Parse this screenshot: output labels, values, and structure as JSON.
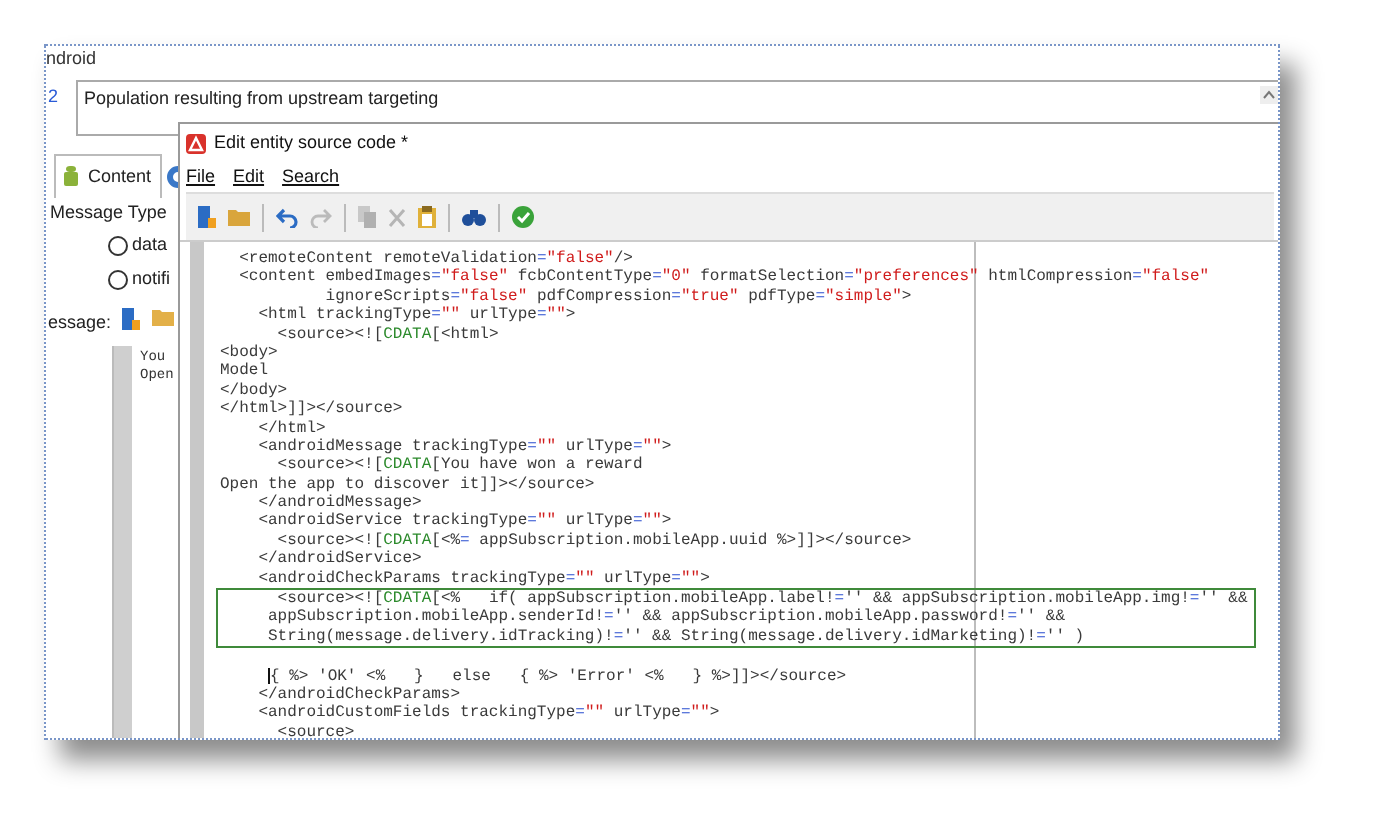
{
  "background_window": {
    "section_title": "ndroid",
    "field_number": "2",
    "description": "Population resulting from upstream targeting",
    "tabs": [
      {
        "label": "Content",
        "selected": true
      }
    ],
    "message_type_label": "Message Type",
    "message_types": [
      {
        "label": "data",
        "selected": false
      },
      {
        "label": "notifi",
        "selected": false
      }
    ],
    "message_label": "essage:",
    "message_preview": [
      "You",
      "Open"
    ]
  },
  "dialog": {
    "title": "Edit entity source code *",
    "menu": [
      "File",
      "Edit",
      "Search"
    ],
    "code_lines": [
      {
        "text": "  <remoteContent remoteValidation=\"false\"/>",
        "highlighted": false,
        "cursor": false
      },
      {
        "text": "  <content embedImages=\"false\" fcbContentType=\"0\" formatSelection=\"preferences\" htmlCompression=\"false\"",
        "highlighted": false,
        "cursor": false
      },
      {
        "text": "           ignoreScripts=\"false\" pdfCompression=\"true\" pdfType=\"simple\">",
        "highlighted": false,
        "cursor": false
      },
      {
        "text": "    <html trackingType=\"\" urlType=\"\">",
        "highlighted": false,
        "cursor": false
      },
      {
        "text": "      <source><![CDATA[<html>",
        "highlighted": false,
        "cursor": false
      },
      {
        "text": "<body>",
        "highlighted": false,
        "cursor": false
      },
      {
        "text": "Model",
        "highlighted": false,
        "cursor": false
      },
      {
        "text": "</body>",
        "highlighted": false,
        "cursor": false
      },
      {
        "text": "</html>]]></source>",
        "highlighted": false,
        "cursor": false
      },
      {
        "text": "    </html>",
        "highlighted": false,
        "cursor": false
      },
      {
        "text": "    <androidMessage trackingType=\"\" urlType=\"\">",
        "highlighted": false,
        "cursor": false
      },
      {
        "text": "      <source><![CDATA[You have won a reward",
        "highlighted": false,
        "cursor": false
      },
      {
        "text": "Open the app to discover it]]></source>",
        "highlighted": false,
        "cursor": false
      },
      {
        "text": "    </androidMessage>",
        "highlighted": false,
        "cursor": false
      },
      {
        "text": "    <androidService trackingType=\"\" urlType=\"\">",
        "highlighted": false,
        "cursor": false
      },
      {
        "text": "      <source><![CDATA[<%= appSubscription.mobileApp.uuid %>]]></source>",
        "highlighted": false,
        "cursor": false
      },
      {
        "text": "    </androidService>",
        "highlighted": false,
        "cursor": false
      },
      {
        "text": "    <androidCheckParams trackingType=\"\" urlType=\"\">",
        "highlighted": false,
        "cursor": false
      },
      {
        "text": "      <source><![CDATA[<%   if( appSubscription.mobileApp.label!='' && appSubscription.mobileApp.img!='' &&",
        "highlighted": true,
        "cursor": false
      },
      {
        "text": "     appSubscription.mobileApp.senderId!='' && appSubscription.mobileApp.password!='' &&",
        "highlighted": true,
        "cursor": false
      },
      {
        "text": "     String(message.delivery.idTracking)!='' && String(message.delivery.idMarketing)!='' )",
        "highlighted": true,
        "cursor": false
      },
      {
        "highlighted": false,
        "cursor": false
      },
      {
        "text": "      { %> 'OK' <%   }   else   { %> 'Error' <%   } %>]]></source>",
        "highlighted": false,
        "cursor": true
      },
      {
        "text": "    </androidCheckParams>",
        "highlighted": false,
        "cursor": false
      },
      {
        "text": "    <androidCustomFields trackingType=\"\" urlType=\"\">",
        "highlighted": false,
        "cursor": false
      },
      {
        "text": "      <source>",
        "highlighted": false,
        "cursor": false
      }
    ]
  }
}
